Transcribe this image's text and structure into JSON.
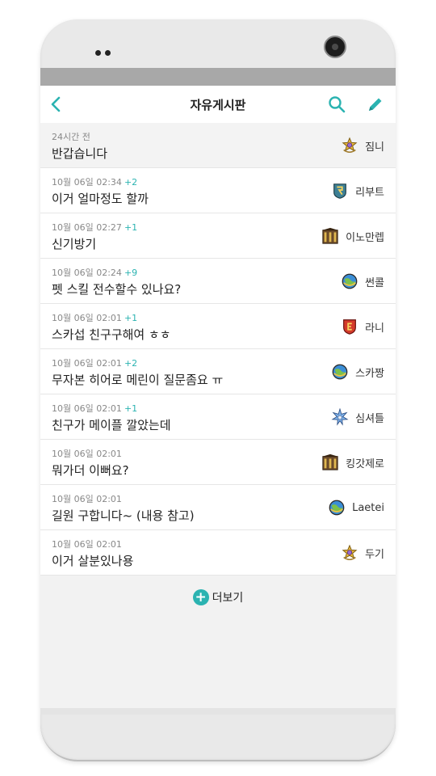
{
  "header": {
    "title": "자유게시판"
  },
  "colors": {
    "accent": "#2bb3b1",
    "status_bar": "#a8a8a8"
  },
  "icons": {
    "back": "chevron-left-icon",
    "search": "search-icon",
    "write": "pencil-icon",
    "more": "plus-circle-icon"
  },
  "posts": [
    {
      "time": "24시간 전",
      "count": "",
      "subject": "반갑습니다",
      "author": "짐니",
      "emblem": "star-crest-emblem"
    },
    {
      "time": "10월 06일 02:34",
      "count": "+2",
      "subject": "이거 얼마정도 할까",
      "author": "리부트",
      "emblem": "reboot-emblem"
    },
    {
      "time": "10월 06일 02:27",
      "count": "+1",
      "subject": "신기방기",
      "author": "이노만렙",
      "emblem": "gate-emblem"
    },
    {
      "time": "10월 06일 02:24",
      "count": "+9",
      "subject": "펫 스킬 전수할수 있나요?",
      "author": "썬콜",
      "emblem": "globe-emblem"
    },
    {
      "time": "10월 06일 02:01",
      "count": "+1",
      "subject": "스카섭 친구구해여 ㅎㅎ",
      "author": "라니",
      "emblem": "red-shield-emblem"
    },
    {
      "time": "10월 06일 02:01",
      "count": "+2",
      "subject": "무자본 히어로 메린이 질문좀요 ㅠ",
      "author": "스카짱",
      "emblem": "globe-emblem"
    },
    {
      "time": "10월 06일 02:01",
      "count": "+1",
      "subject": "친구가 메이플 깔았는데",
      "author": "심셔틀",
      "emblem": "blue-star-emblem"
    },
    {
      "time": "10월 06일 02:01",
      "count": "",
      "subject": "뭐가더 이뻐요?",
      "author": "킹갓제로",
      "emblem": "gate-emblem"
    },
    {
      "time": "10월 06일 02:01",
      "count": "",
      "subject": "길원 구합니다~ (내용 참고)",
      "author": "Laetei",
      "emblem": "globe-emblem"
    },
    {
      "time": "10월 06일 02:01",
      "count": "",
      "subject": "이거 살분있나용",
      "author": "두기",
      "emblem": "star-crest-emblem"
    }
  ],
  "more": {
    "label": "더보기"
  }
}
